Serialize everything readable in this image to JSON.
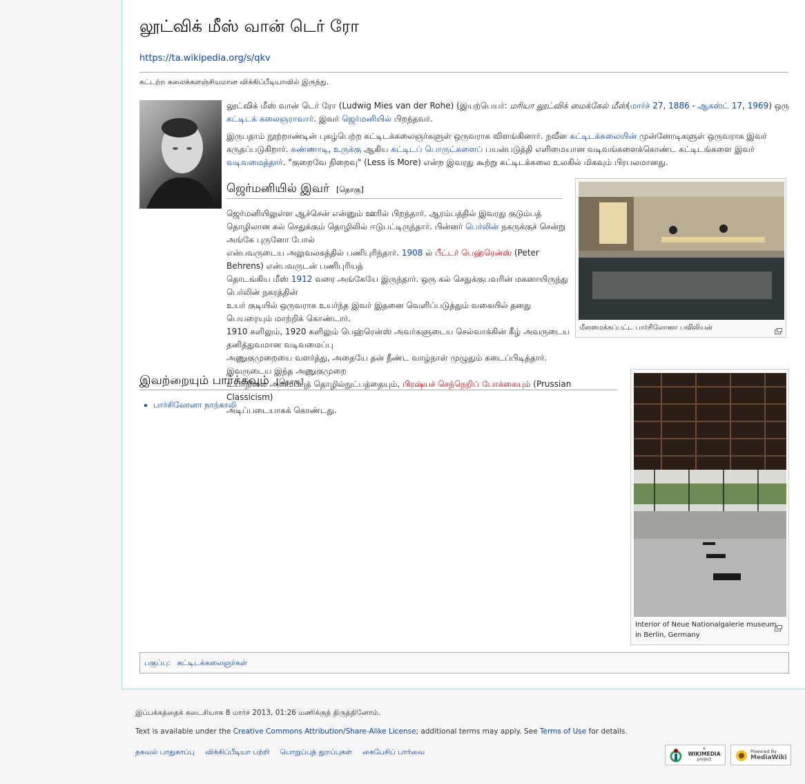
{
  "article": {
    "title": "லூட்விக் மீஸ் வான் டெர் ரோ",
    "short_url": "https://ta.wikipedia.org/s/qkv",
    "tagline": "கட்டற்ற கலைக்களஞ்சியமான விக்கிப்பீடியாவில் இருந்து."
  },
  "intro": {
    "l1_a": "லூட்விக் மீஸ் வான் டெர் ரோ (Ludwig Mies van der Rohe) (இயற்பெயர்: ",
    "l1_birthname": "மரியா லூட்விக் மைக்கேல் மீஸ்",
    "l1_open": "(",
    "l1_link1": "மார்ச் 27",
    "l1_comma1": ", ",
    "l1_link2": "1886",
    "l1_dash": " - ",
    "l1_link3": "ஆகஸ்ட் 17",
    "l1_comma2": ", ",
    "l1_link4": "1969",
    "l1_b": ") ஒரு",
    "l2_link1": "கட்டிடக் கலைஞராவார்",
    "l2_a": ". இவர் ",
    "l2_link2": "ஜெர்மனியில்",
    "l2_b": " பிறந்தவர்.",
    "p2_l1_a": "இருபதாம் நூற்றாண்டின் புகழ்பெற்ற கட்டிடக்கலைஞர்களுள் ஒருவராக விளங்கினார். நவீன ",
    "p2_l1_link": "கட்டிடக்கலையின்",
    "p2_l1_b": " முன்னோடிகளுள் ஒருவராக இவர்",
    "p2_l2_a": "கருதப்படுகிறார். ",
    "p2_l2_link1": "கண்ணாடி",
    "p2_l2_comma": ", ",
    "p2_l2_link2": "உருக்கு",
    "p2_l2_b": " ஆகிய ",
    "p2_l2_link3": "கட்டிடப் பொருட்களைப்",
    "p2_l2_c": " பயன்படுத்தி எளிமையான வடிவங்களைக்கொண்ட கட்டிடங்களை இவர்",
    "p2_l3_link": "வடிவமைத்தார்",
    "p2_l3_a": ". \"குறைவே நிறைவு\" (Less is More) என்ற இவரது கூற்று கட்டிடக்கலை உலகில் மிகவும் பிரபலமானது."
  },
  "section_germany": {
    "heading": "ஜெர்மனியில் இவர்",
    "edit": "[தொகு]",
    "l1": "ஜெர்மனியிலுள்ள ஆச்சென் என்னும் ஊரில் பிறந்தார். ஆரம்பத்தில் இவரது குடும்பத்",
    "l2": "தொழிலான கல் செதுக்கும் தொழிலில் ஈடுபட்டிருந்தார். பின்னர் ",
    "l2_link": "பெர்லின்",
    "l2_b": " நகருக்குச் சென்று அங்கே புருனோ போல்",
    "l3_a": "என்பவருடைய அலுவலகத்தில் பணிபுரிந்தார். ",
    "l3_link1": "1908",
    "l3_b": " ல் ",
    "l3_red": "பீட்டர் பெஹ்ரென்ஸ்",
    "l3_c": " (Peter Behrens) என்பவருடன் பணிபுரியத்",
    "l4_a": "தொடங்கிய மீஸ் ",
    "l4_link": "1912",
    "l4_b": " வரை அங்கேயே இருந்தார். ஒரு கல் செதுக்குபவரின் மகனாயிருந்து பெர்லின் நகரத்தின்",
    "l5": "உயர் குடியில் ஒருவராக உயர்ந்த இவர் இதனை வெளிப்படுத்தும் வகையில் தனது பெயரையும் மாற்றிக் கொண்டார்.",
    "l6": "1910 களிலும், 1920 களிலும் பெஹ்ரென்ஸ் அவர்களுடைய செல்வாக்கின் கீழ் அவருடைய தனித்துவமான வடிவமைப்பு",
    "l7": "அணுகுமுறையை வளர்த்து, அதையே தன் நீண்ட வாழ்நாள் முழுதும் கடைப்பிடித்தார். இவருடைய இந்த அணுகுமுறை",
    "l8_a": "உயர்நிலை அமைப்புத் தொழில்நுட்பத்தையும், ",
    "l8_red": "பிரஷ்யச் செந்நெறிப் போக்கையும்",
    "l8_b": " (Prussian Classicism)",
    "l9": "அடிப்படையாகக் கொண்டது."
  },
  "thumb_pavilion": {
    "caption": "மீளமைக்கப்பட்ட பார்சிலோனா பவிலியன்"
  },
  "section_seealso": {
    "heading": "இவற்றையும் பார்க்கவும்",
    "edit": "[தொகு]",
    "items": [
      "பார்சிலோனா நாற்காலி"
    ]
  },
  "thumb_galerie": {
    "caption_l1": "Interior of Neue Nationalgalerie museum",
    "caption_l2": "in Berlin, Germany"
  },
  "catlinks": {
    "label": "பகுப்பு:",
    "category": "கட்டிடக்கலைஞர்கள்"
  },
  "footer": {
    "lastmod": "இப்பக்கத்தைக் கடைசியாக 8 மார்ச் 2013, 01:26 மணிக்குத் திருத்தினோம்.",
    "license_a": "Text is available under the ",
    "license_link": "Creative Commons Attribution/Share-Alike License",
    "license_b": "; additional terms may apply. See ",
    "terms_link": "Terms of Use",
    "license_c": " for details.",
    "places": [
      "தகவல் பாதுகாப்பு",
      "விக்கிப்பீடியா பற்றி",
      "பொறுப்புத் துறப்புகள்",
      "கைபேசிப் பார்வை"
    ],
    "wikimedia_badge_l1": "a",
    "wikimedia_badge_l2": "WIKIMEDIA",
    "wikimedia_badge_l3": "project",
    "mediawiki_badge_l1": "Powered By",
    "mediawiki_badge_l2": "MediaWiki"
  },
  "icons": {
    "magnify": "magnify-clip-icon"
  },
  "colors": {
    "link": "#0645ad",
    "redlink": "#ba0000",
    "border": "#a7d7f9"
  }
}
